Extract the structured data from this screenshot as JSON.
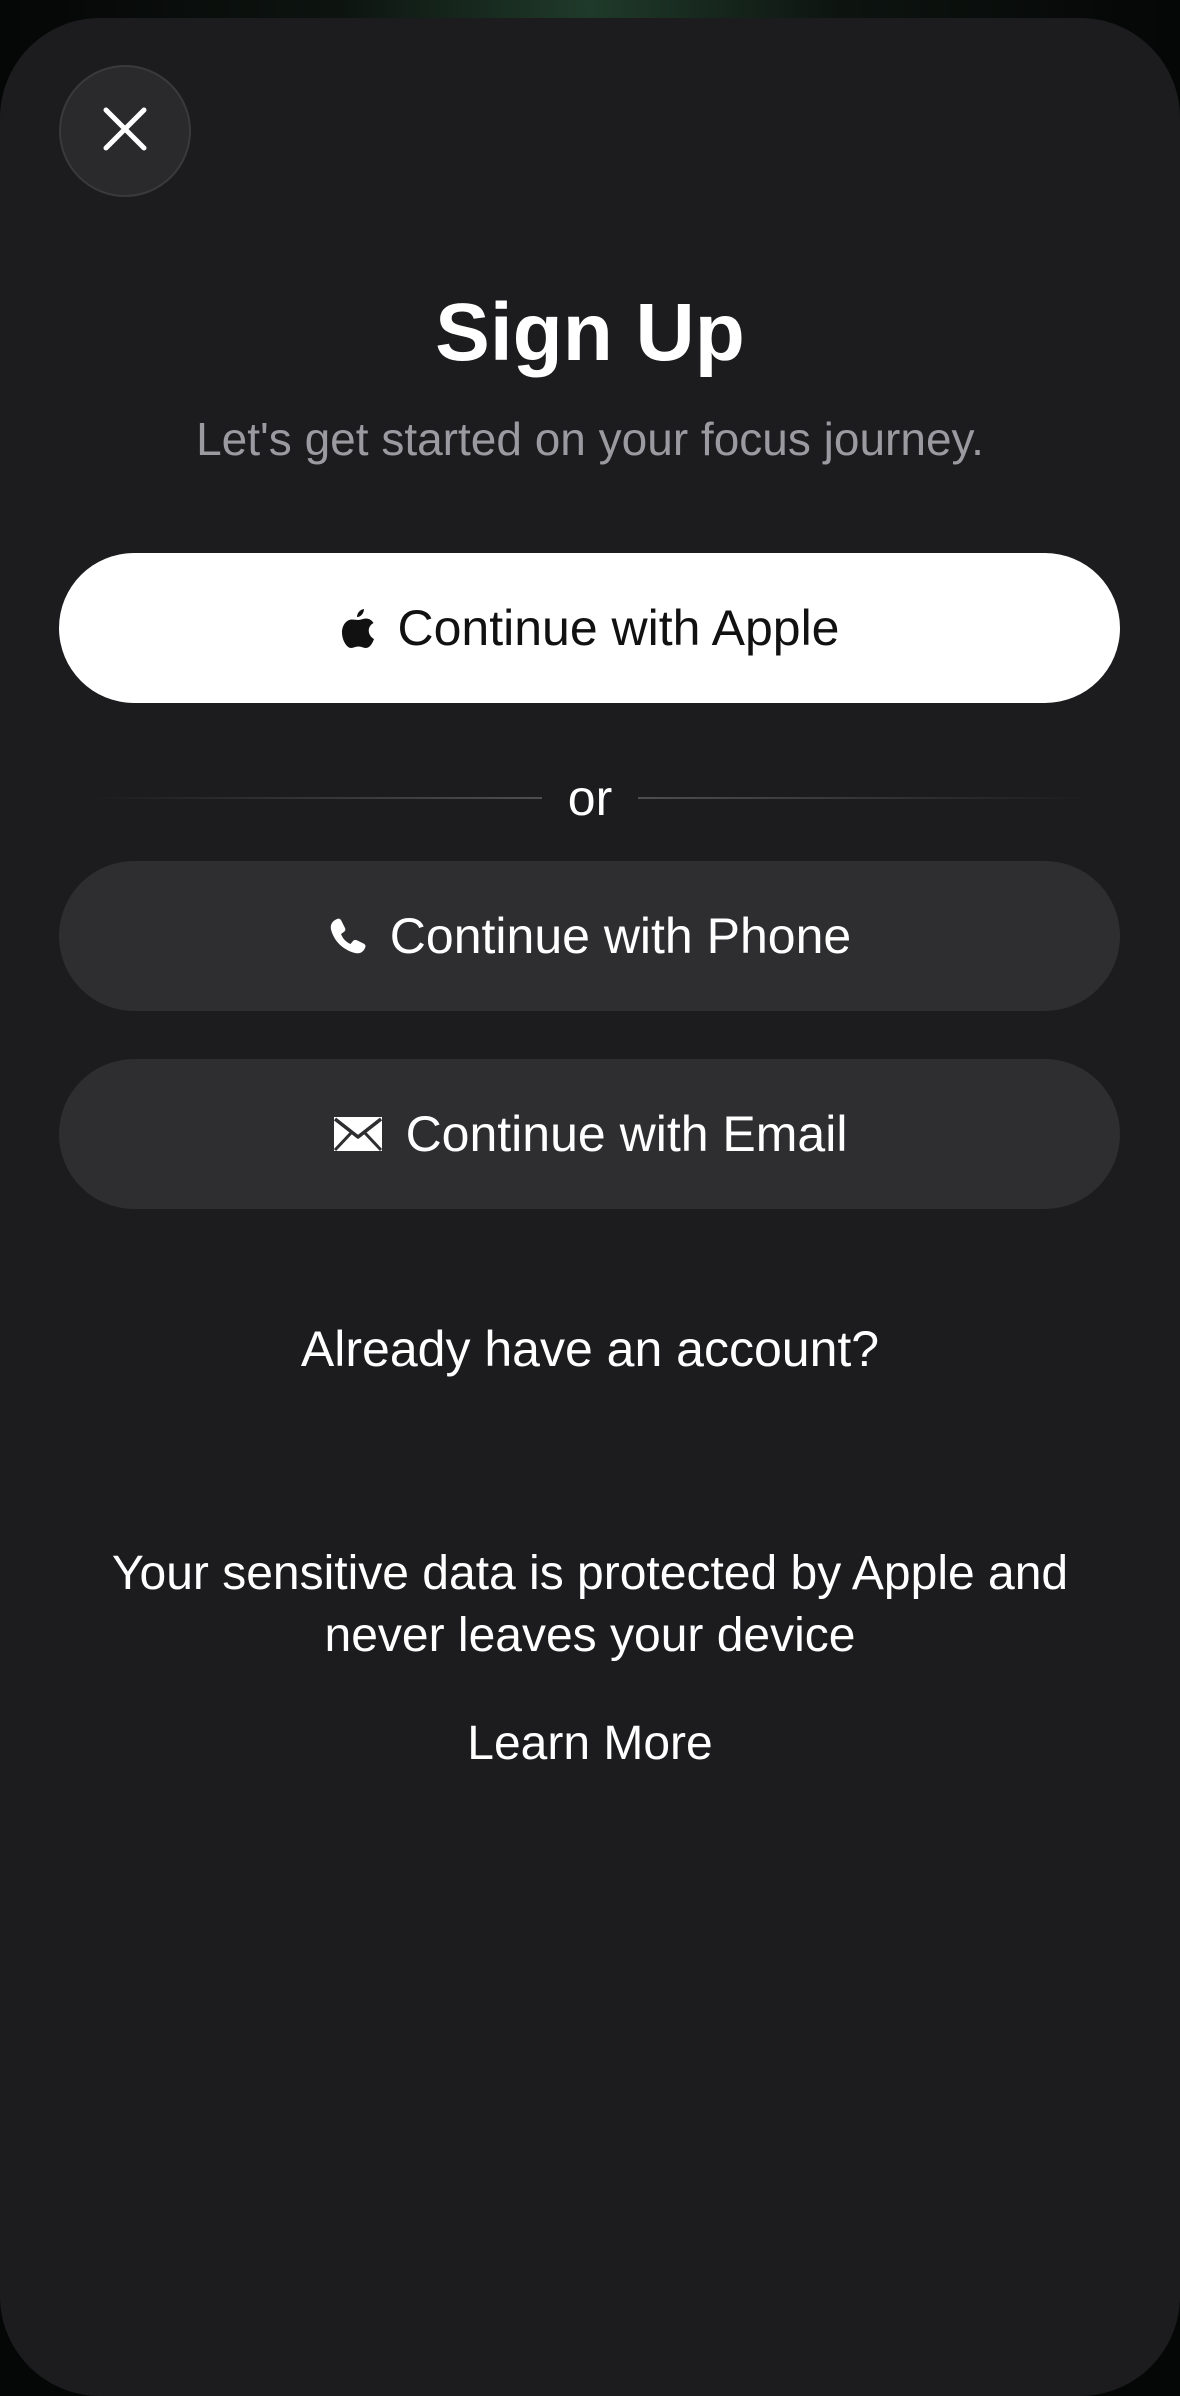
{
  "header": {
    "close_icon": "close-icon",
    "title": "Sign Up",
    "subtitle": "Let's get started on your focus journey."
  },
  "auth": {
    "apple_label": "Continue with Apple",
    "apple_icon": "apple-logo-icon",
    "divider_text": "or",
    "phone_label": "Continue with Phone",
    "phone_icon": "phone-icon",
    "email_label": "Continue with Email",
    "email_icon": "envelope-icon"
  },
  "account_link": "Already have an account?",
  "privacy": {
    "line1": "Your sensitive data is protected by Apple and",
    "line2": "never leaves your device",
    "learn_more": "Learn More"
  },
  "colors": {
    "sheet_background": "#1c1c1e",
    "primary_button": "#ffffff",
    "secondary_button": "#2e2e31",
    "subtitle_text": "#9a9aa0"
  }
}
